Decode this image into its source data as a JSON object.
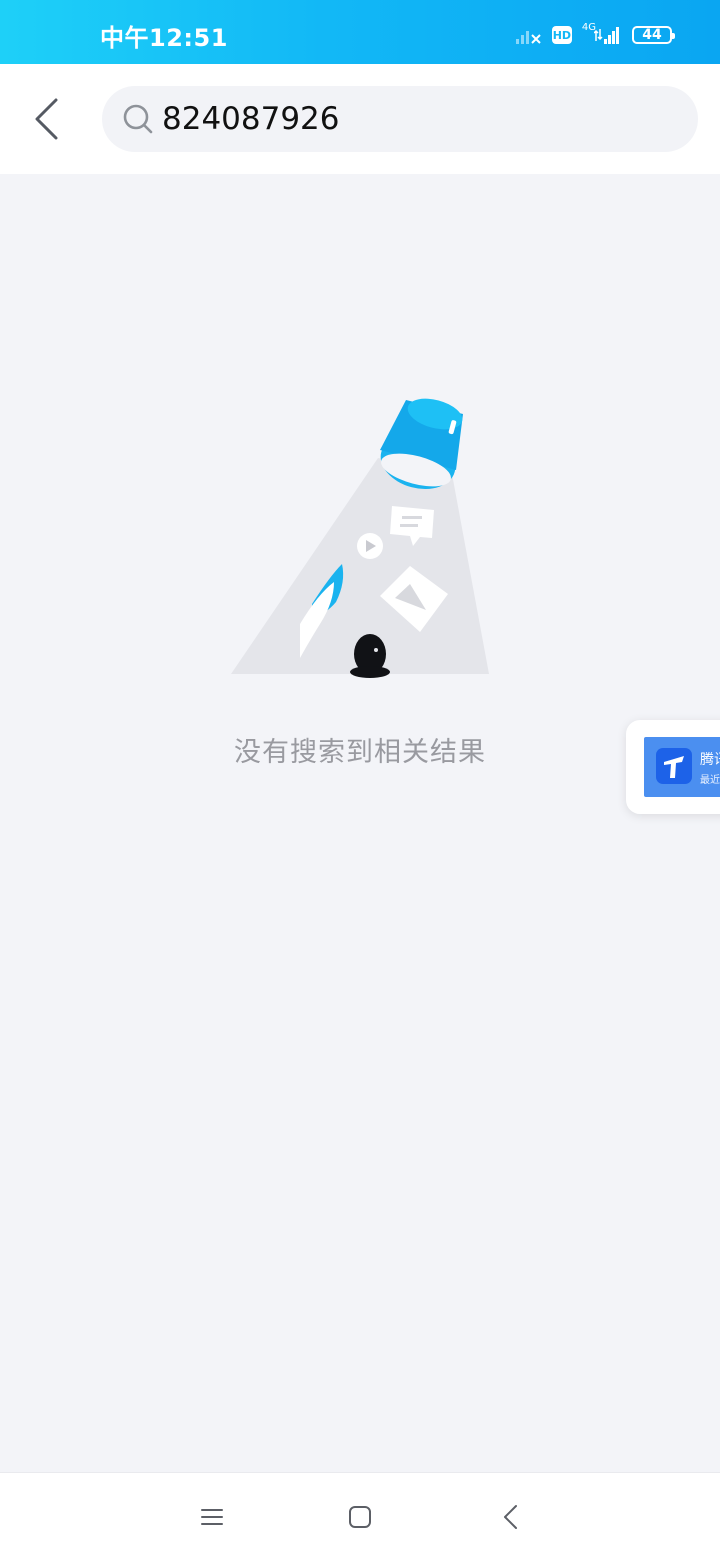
{
  "status_bar": {
    "time": "中午12:51",
    "hd": "HD",
    "network": "4G",
    "battery": "44"
  },
  "search": {
    "query": "824087926",
    "placeholder": ""
  },
  "empty_state": {
    "message": "没有搜索到相关结果"
  },
  "floating_card": {
    "title": "腾讯",
    "subtitle": "最近"
  },
  "colors": {
    "accent": "#12b8f6",
    "background": "#f3f4f8"
  },
  "icons": [
    "back-arrow-icon",
    "search-icon",
    "menu-icon",
    "home-square-icon",
    "back-chevron-icon"
  ]
}
